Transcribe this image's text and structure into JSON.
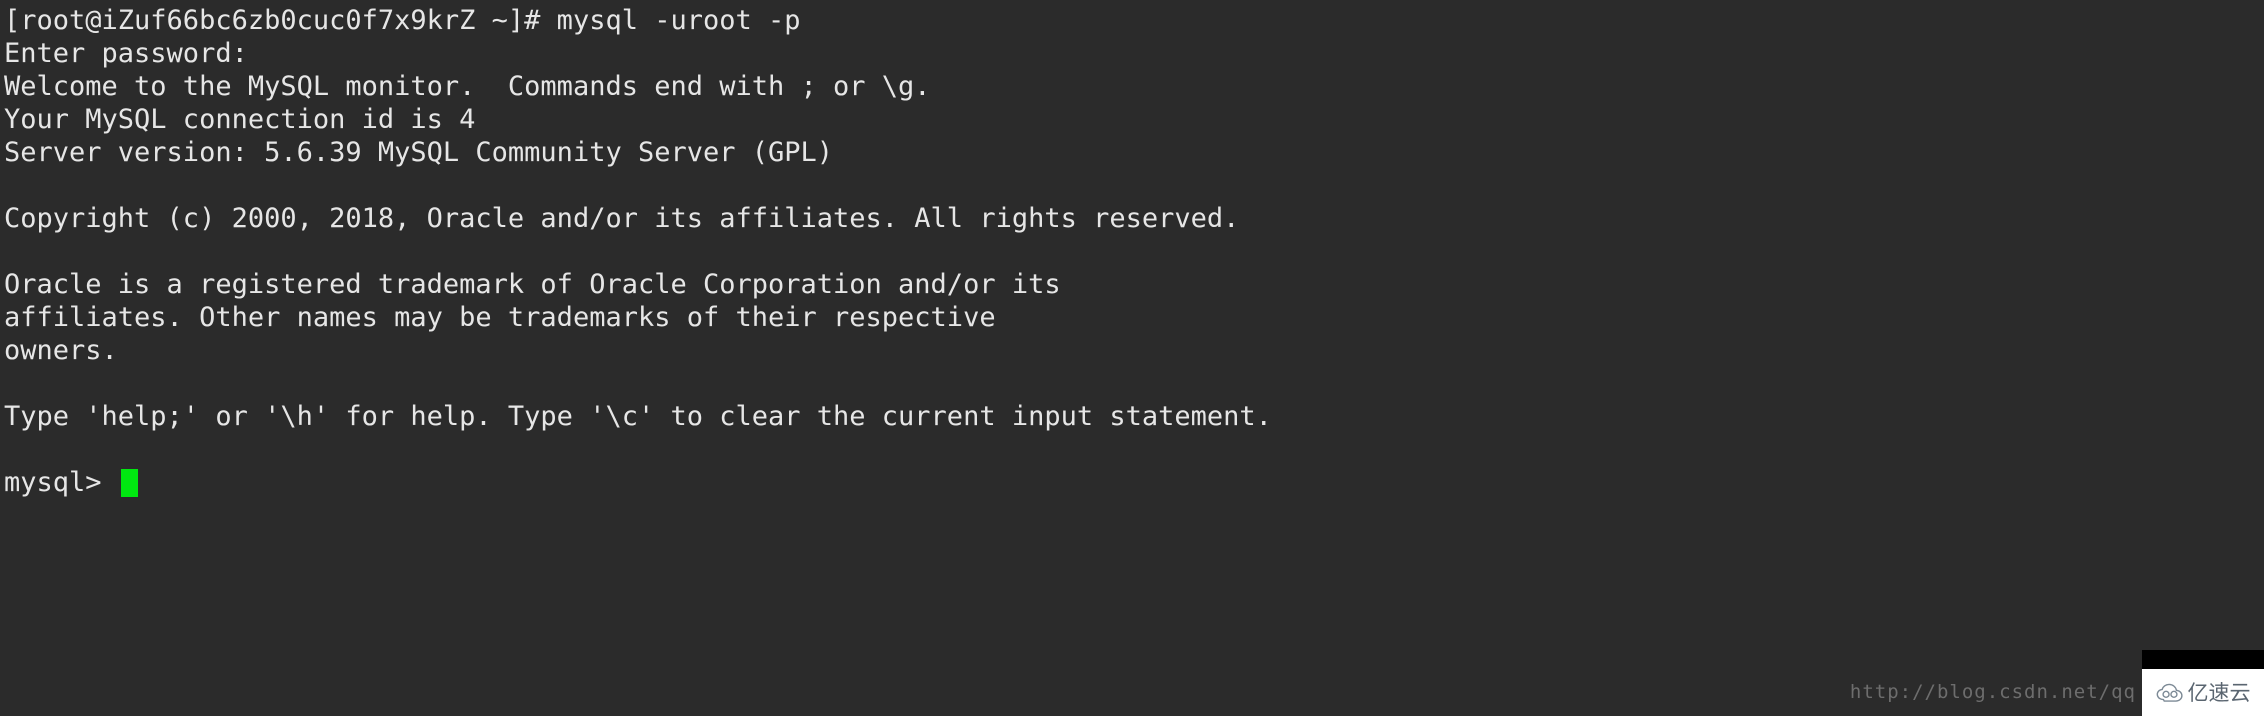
{
  "terminal": {
    "background_color": "#2b2b2b",
    "text_color": "#e6e6e6",
    "cursor_color": "#00e810",
    "lines": [
      "[root@iZuf66bc6zb0cuc0f7x9krZ ~]# mysql -uroot -p",
      "Enter password:",
      "Welcome to the MySQL monitor.  Commands end with ; or \\g.",
      "Your MySQL connection id is 4",
      "Server version: 5.6.39 MySQL Community Server (GPL)",
      "",
      "Copyright (c) 2000, 2018, Oracle and/or its affiliates. All rights reserved.",
      "",
      "Oracle is a registered trademark of Oracle Corporation and/or its",
      "affiliates. Other names may be trademarks of their respective",
      "owners.",
      "",
      "Type 'help;' or '\\h' for help. Type '\\c' to clear the current input statement.",
      ""
    ],
    "prompt": "mysql> ",
    "cursor": "block-cursor"
  },
  "watermark": {
    "url": "http://blog.csdn.net/qq",
    "brand_text": "亿速云",
    "brand_icon": "cloud-icon"
  }
}
